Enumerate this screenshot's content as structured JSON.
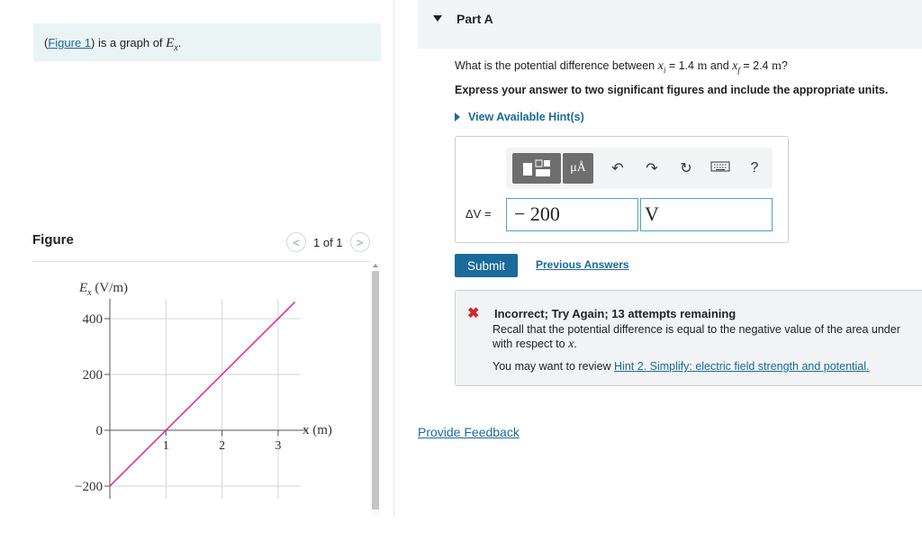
{
  "intro": {
    "link": "Figure 1",
    "open": "(",
    "close": ")",
    "text": " is a graph of ",
    "symbol_base": "E",
    "symbol_sub": "x",
    "period": "."
  },
  "figure": {
    "title": "Figure",
    "pager_text": "1 of 1",
    "prev_glyph": "<",
    "next_glyph": ">"
  },
  "chart_data": {
    "type": "line",
    "ylabel_base": "E",
    "ylabel_sub": "x",
    "ylabel_unit": " (V/m)",
    "xlabel": "x (m)",
    "x_ticks": [
      "1",
      "2",
      "3"
    ],
    "y_ticks": [
      "400",
      "200",
      "0",
      "−200"
    ],
    "xlim": [
      0,
      3.4
    ],
    "ylim": [
      -200,
      400
    ],
    "grid": true,
    "series": [
      {
        "x": [
          0,
          3.3
        ],
        "y": [
          -200,
          460
        ],
        "color": "#e0338c"
      }
    ]
  },
  "part": {
    "title": "Part A"
  },
  "question": {
    "lead": "What is the potential difference between ",
    "xi": "x",
    "xi_sub": "i",
    "eq1": " = 1.4 ",
    "m1": "m",
    "and": " and ",
    "xf": "x",
    "xf_sub": "f",
    "eq2": " = 2.4 ",
    "m2": "m",
    "tail": "?"
  },
  "instruction": "Express your answer to two significant figures and include the appropriate units.",
  "hints_label": "View Available Hint(s)",
  "answer": {
    "label": "ΔV =",
    "value": "− 200",
    "unit": "V",
    "mu_button": "μÅ",
    "help": "?"
  },
  "submit_label": "Submit",
  "previous_answers": "Previous Answers",
  "feedback": {
    "title": "Incorrect; Try Again; 13 attempts remaining",
    "line1": "Recall that the potential difference is equal to the negative value of the area under",
    "line2_prefix": "with respect to ",
    "line2_var": "x",
    "line2_suffix": ".",
    "review_prefix": "You may want to review ",
    "review_link": "Hint 2. Simplify: electric field strength and potential."
  },
  "provide_feedback": "Provide Feedback",
  "colors": {
    "accent": "#1a6a9a",
    "error": "#d0262d",
    "line": "#e0338c"
  }
}
